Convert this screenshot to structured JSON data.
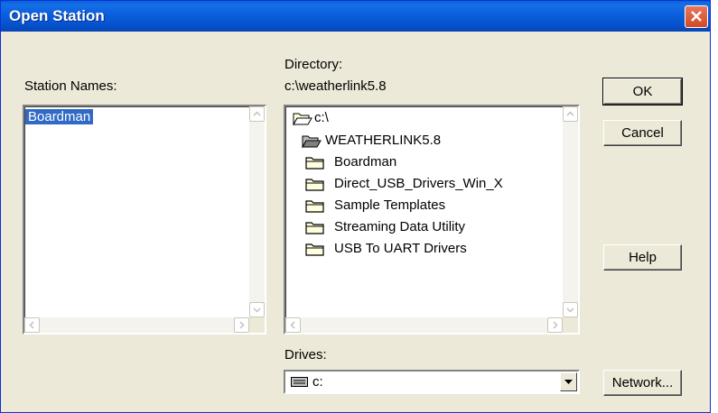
{
  "window": {
    "title": "Open Station"
  },
  "station_names": {
    "label": "Station Names:",
    "items": [
      "Boardman"
    ],
    "selected": "Boardman"
  },
  "directory": {
    "label": "Directory:",
    "path": "c:\\weatherlink5.8",
    "tree": [
      {
        "name": "c:\\",
        "icon": "open-folder-icon"
      },
      {
        "name": "WEATHERLINK5.8",
        "icon": "open-folder-icon"
      },
      {
        "name": "Boardman",
        "icon": "folder-icon"
      },
      {
        "name": "Direct_USB_Drivers_Win_X",
        "icon": "folder-icon"
      },
      {
        "name": "Sample Templates",
        "icon": "folder-icon"
      },
      {
        "name": "Streaming Data Utility",
        "icon": "folder-icon"
      },
      {
        "name": "USB To UART Drivers",
        "icon": "folder-icon"
      }
    ]
  },
  "drives": {
    "label": "Drives:",
    "selected": "c:"
  },
  "buttons": {
    "ok": "OK",
    "cancel": "Cancel",
    "help": "Help",
    "network": "Network..."
  },
  "colors": {
    "titlebar": "#0b5fdc",
    "dialog_bg": "#ece9d8",
    "selection": "#316ac5",
    "close": "#d14a26"
  }
}
